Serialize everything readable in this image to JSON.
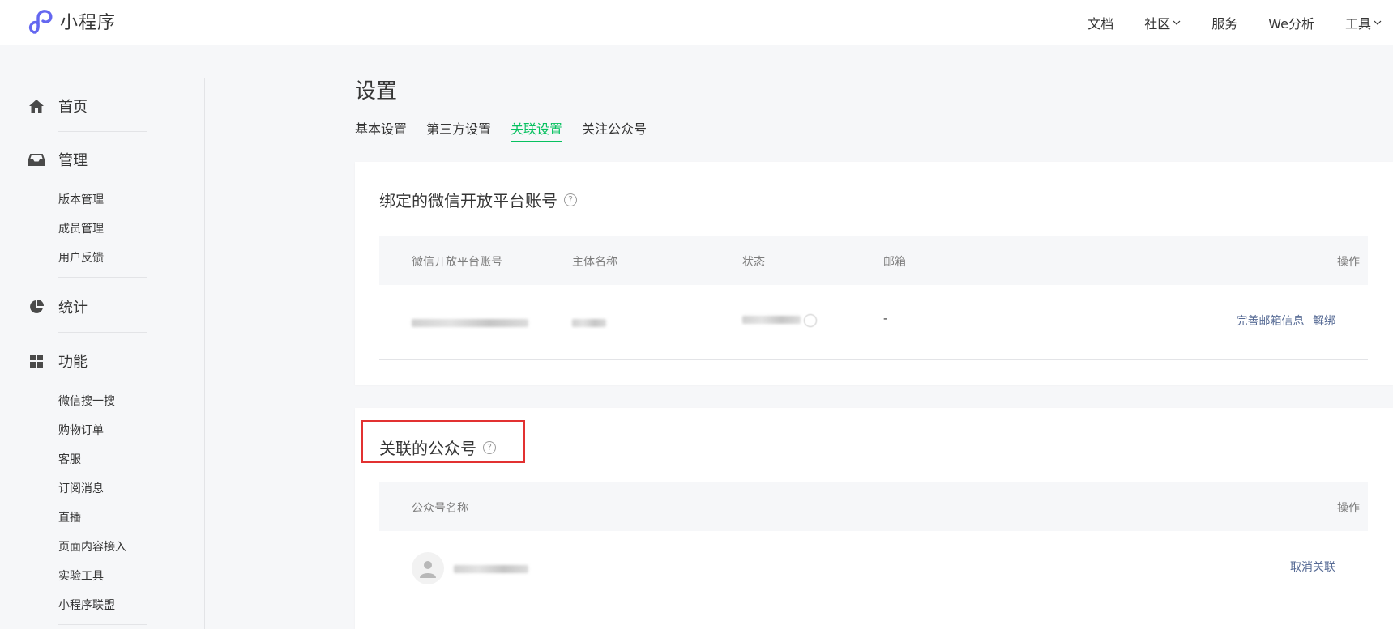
{
  "header": {
    "logo_text": "小程序",
    "nav": [
      {
        "label": "文档",
        "has_dropdown": false
      },
      {
        "label": "社区",
        "has_dropdown": true
      },
      {
        "label": "服务",
        "has_dropdown": false
      },
      {
        "label": "We分析",
        "has_dropdown": false
      },
      {
        "label": "工具",
        "has_dropdown": true
      }
    ]
  },
  "sidebar": {
    "home": "首页",
    "manage": "管理",
    "manage_items": [
      "版本管理",
      "成员管理",
      "用户反馈"
    ],
    "stats": "统计",
    "features": "功能",
    "feature_items": [
      "微信搜一搜",
      "购物订单",
      "客服",
      "订阅消息",
      "直播",
      "页面内容接入",
      "实验工具",
      "小程序联盟"
    ]
  },
  "page": {
    "title": "设置",
    "tabs": [
      {
        "label": "基本设置",
        "active": false
      },
      {
        "label": "第三方设置",
        "active": false
      },
      {
        "label": "关联设置",
        "active": true
      },
      {
        "label": "关注公众号",
        "active": false
      }
    ]
  },
  "open_platform": {
    "title": "绑定的微信开放平台账号",
    "help": "?",
    "columns": [
      "微信开放平台账号",
      "主体名称",
      "状态",
      "邮箱",
      "操作"
    ],
    "row": {
      "email": "-",
      "actions": [
        "完善邮箱信息",
        "解绑"
      ]
    }
  },
  "official_account": {
    "title": "关联的公众号",
    "help": "?",
    "columns": [
      "公众号名称",
      "操作"
    ],
    "row": {
      "action": "取消关联"
    }
  },
  "colors": {
    "accent": "#07c160",
    "link": "#576b95",
    "highlight": "#e23131"
  }
}
